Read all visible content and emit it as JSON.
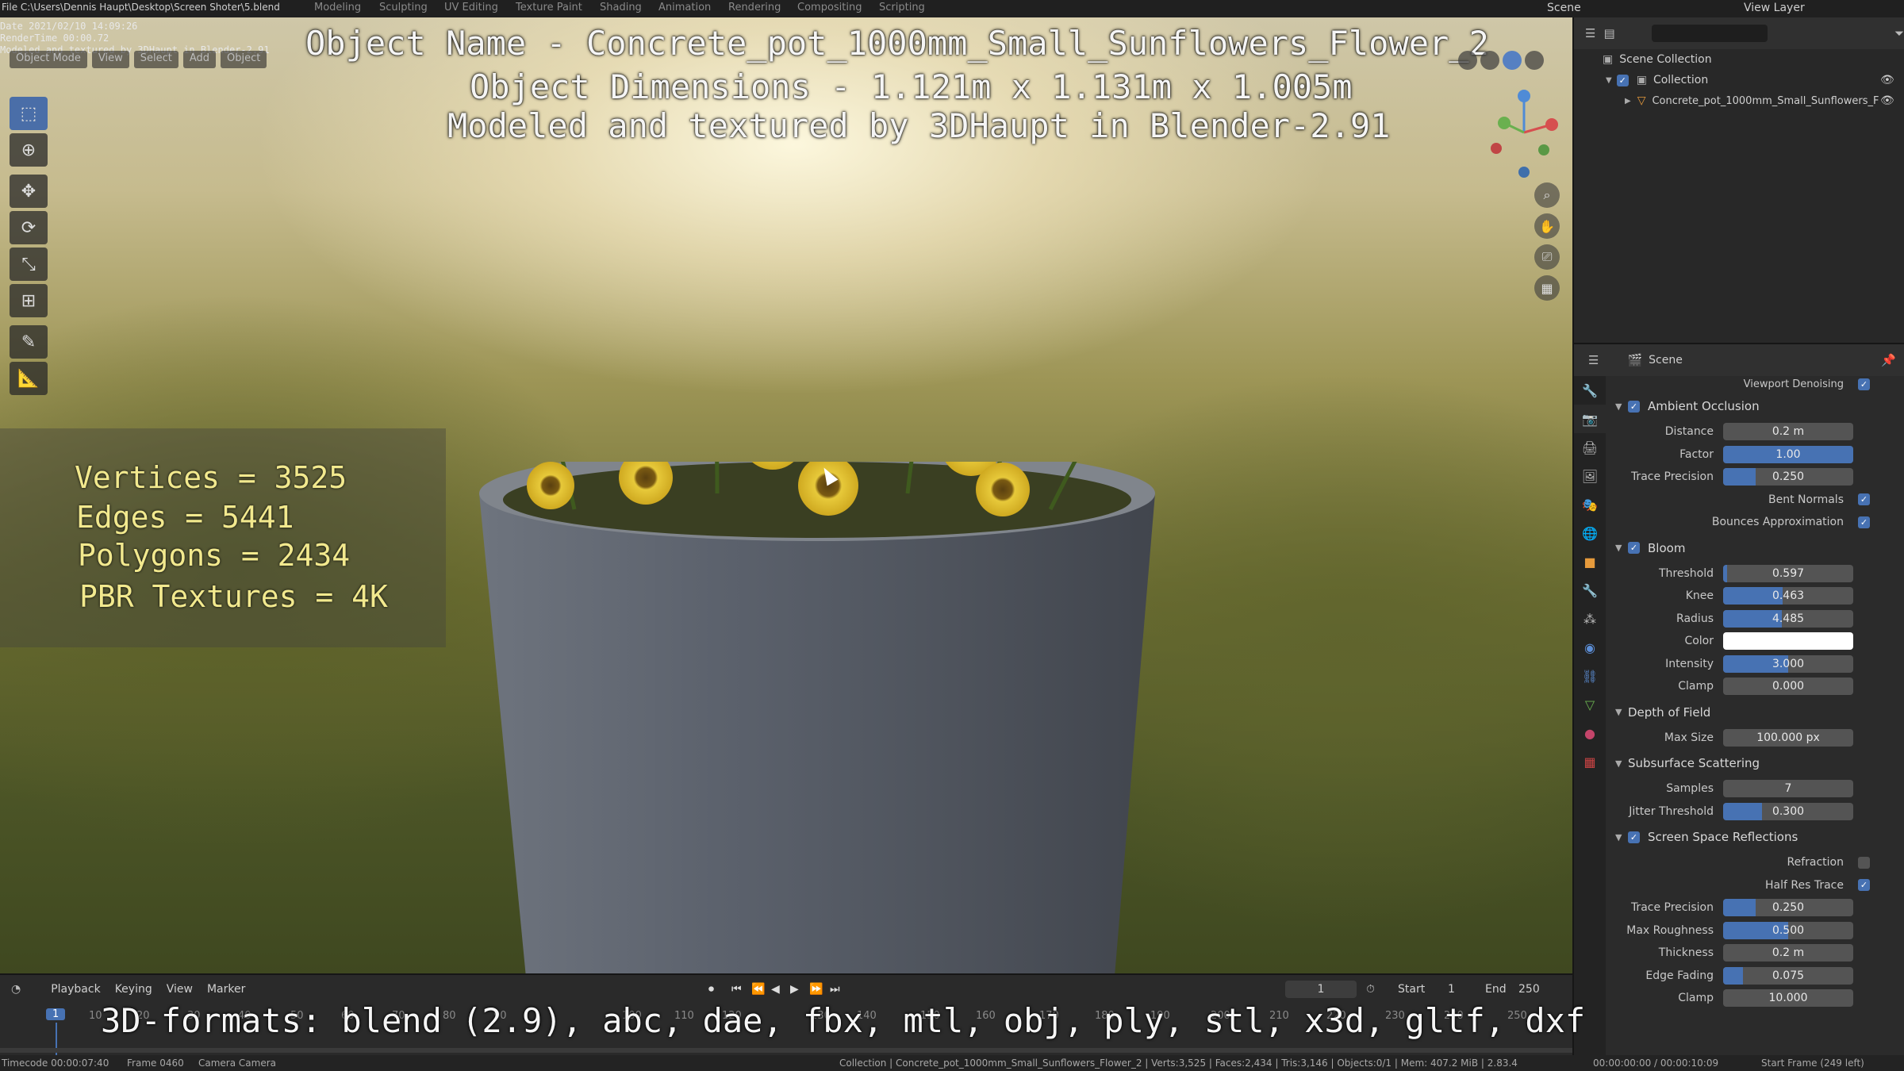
{
  "topbar": {
    "file_path": "File C:\\Users\\Dennis Haupt\\Desktop\\Screen Shoter\\5.blend",
    "workspaces": [
      "Modeling",
      "Sculpting",
      "UV Editing",
      "Texture Paint",
      "Shading",
      "Animation",
      "Rendering",
      "Compositing",
      "Scripting"
    ],
    "scene": "Scene",
    "view_layer": "View Layer"
  },
  "viewport": {
    "info_lines": [
      "Date 2021/02/10 14:09:26",
      "RenderTime 00:00.72",
      "Modeled and textured by 3DHaupt in Blender-2.91"
    ],
    "header_items": [
      "Object Mode",
      "View",
      "Select",
      "Add",
      "Object"
    ],
    "title_line1": "Object Name - Concrete_pot_1000mm_Small_Sunflowers_Flower_2",
    "title_line2": "Object Dimensions -  1.121m x 1.131m x 1.005m",
    "title_line3": "Modeled and textured by 3DHaupt in Blender-2.91",
    "stats": [
      "Vertices = 3525",
      "Edges = 5441",
      "Polygons = 2434",
      "PBR Textures = 4K"
    ],
    "formats": "3D-formats: blend (2.9), abc, dae, fbx, mtl, obj, ply, stl, x3d, gltf, dxf"
  },
  "outliner": {
    "root": "Scene Collection",
    "collection": "Collection",
    "object": "Concrete_pot_1000mm_Small_Sunflowers_F"
  },
  "properties": {
    "context": "Scene",
    "viewport_denoising": "Viewport Denoising",
    "ambient_occlusion": {
      "title": "Ambient Occlusion",
      "distance_label": "Distance",
      "distance": "0.2 m",
      "factor_label": "Factor",
      "factor": "1.00",
      "factor_fill": 1.0,
      "trace_label": "Trace Precision",
      "trace": "0.250",
      "trace_fill": 0.25,
      "bent_normals": "Bent Normals",
      "bounces": "Bounces Approximation"
    },
    "bloom": {
      "title": "Bloom",
      "threshold_label": "Threshold",
      "threshold": "0.597",
      "threshold_fill": 0.03,
      "knee_label": "Knee",
      "knee": "0.463",
      "knee_fill": 0.46,
      "radius_label": "Radius",
      "radius": "4.485",
      "radius_fill": 0.45,
      "color_label": "Color",
      "intensity_label": "Intensity",
      "intensity": "3.000",
      "intensity_fill": 0.5,
      "clamp_label": "Clamp",
      "clamp": "0.000"
    },
    "dof": {
      "title": "Depth of Field",
      "max_size_label": "Max Size",
      "max_size": "100.000 px"
    },
    "sss": {
      "title": "Subsurface Scattering",
      "samples_label": "Samples",
      "samples": "7",
      "jitter_label": "Jitter Threshold",
      "jitter": "0.300",
      "jitter_fill": 0.3
    },
    "ssr": {
      "title": "Screen Space Reflections",
      "refraction": "Refraction",
      "half_res": "Half Res Trace",
      "trace_label": "Trace Precision",
      "trace": "0.250",
      "trace_fill": 0.25,
      "roughness_label": "Max Roughness",
      "roughness": "0.500",
      "roughness_fill": 0.5,
      "thickness_label": "Thickness",
      "thickness": "0.2 m",
      "edge_label": "Edge Fading",
      "edge": "0.075",
      "edge_fill": 0.15,
      "clamp_label": "Clamp",
      "clamp": "10.000"
    }
  },
  "timeline": {
    "menus": [
      "Playback",
      "Keying",
      "View",
      "Marker"
    ],
    "current_frame": "1",
    "start_label": "Start",
    "start": "1",
    "end_label": "End",
    "end": "250",
    "ruler": [
      "1",
      "10",
      "20",
      "30",
      "40",
      "50",
      "60",
      "70",
      "80",
      "90",
      "100",
      "110",
      "120",
      "130",
      "140",
      "150",
      "160",
      "170",
      "180",
      "190",
      "200",
      "210",
      "220",
      "230",
      "240",
      "250"
    ]
  },
  "statusbar": {
    "timecode": "Timecode 00:00:07:40",
    "frame": "Frame 0460",
    "camera": "Camera Camera",
    "info": "Collection | Concrete_pot_1000mm_Small_Sunflowers_Flower_2 | Verts:3,525 | Faces:2,434 | Tris:3,146 | Objects:0/1 | Mem: 407.2 MiB | 2.83.4",
    "time": "00:00:00:00 / 00:00:10:09",
    "start_frame": "Start Frame (249 left)"
  }
}
